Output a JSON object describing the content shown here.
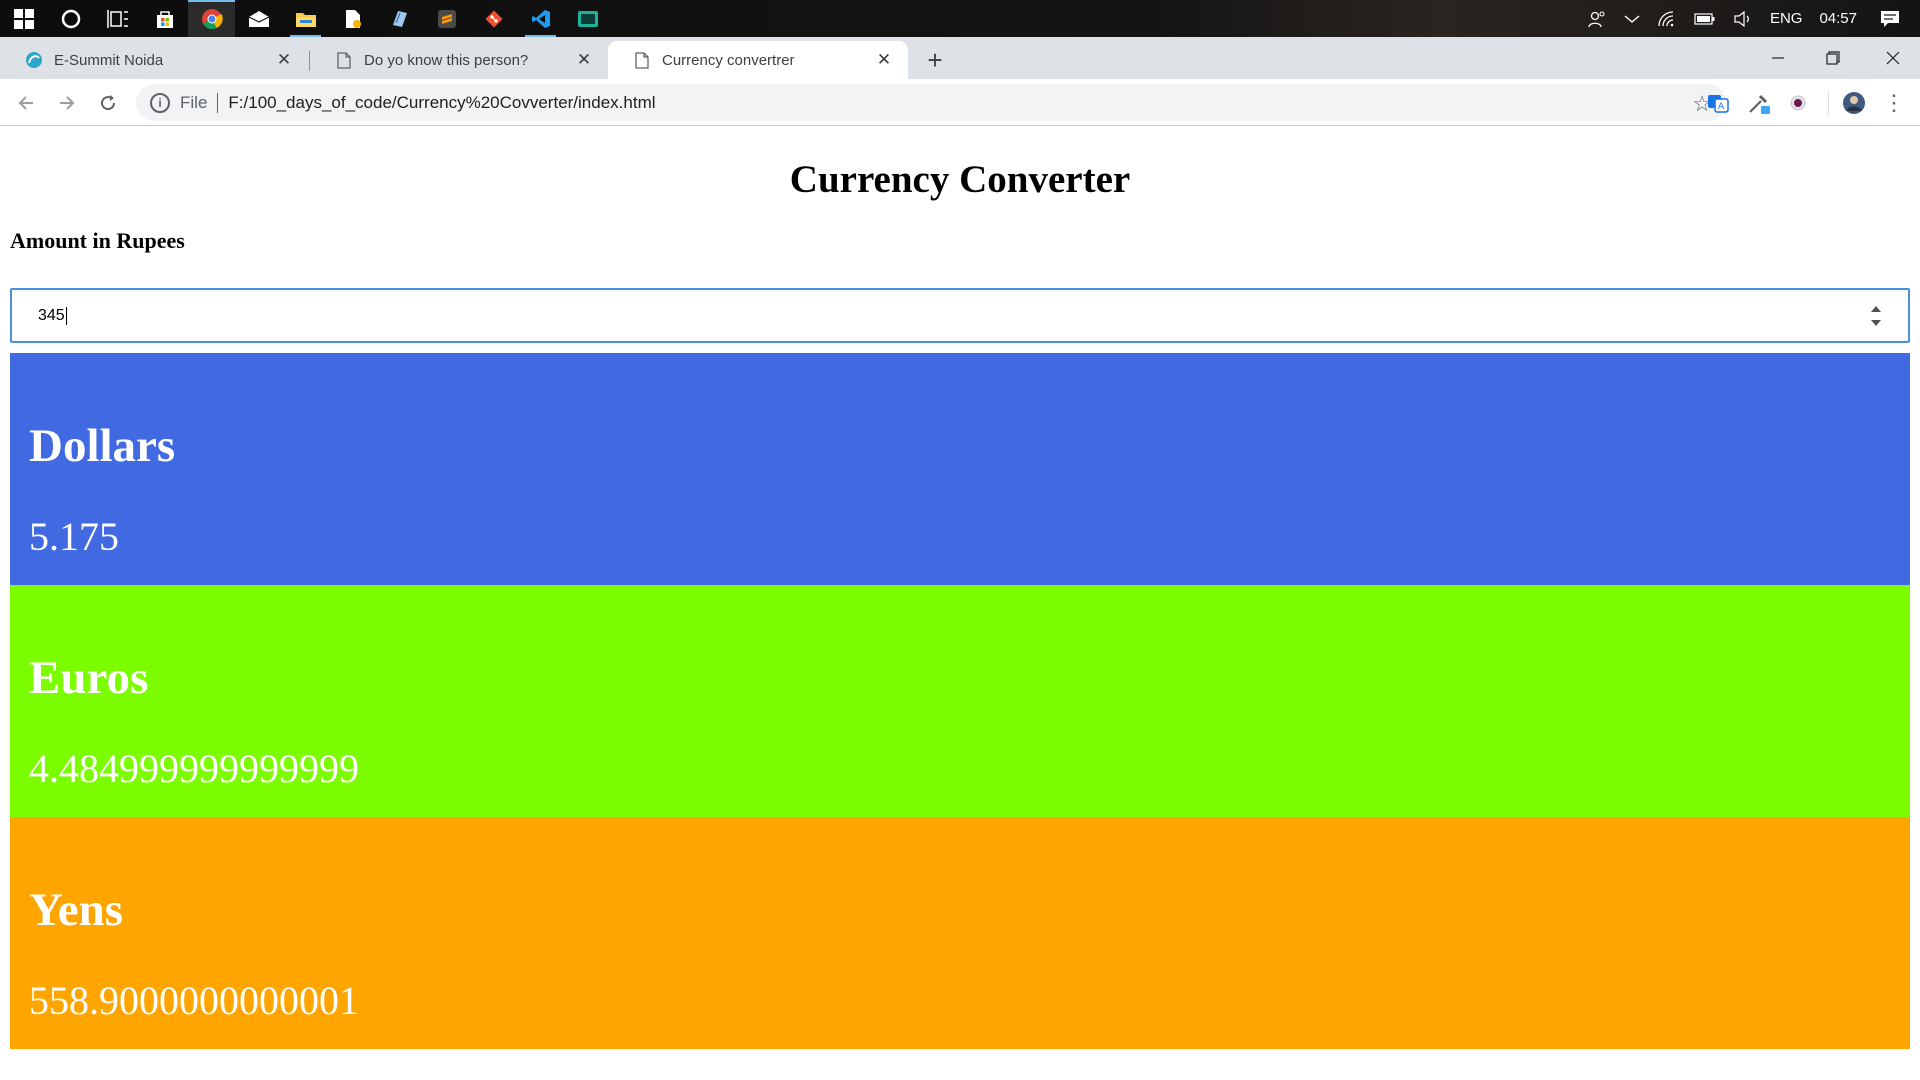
{
  "taskbar": {
    "icons": [
      "windows-start-icon",
      "cortana-search-icon",
      "task-view-icon",
      "store-icon",
      "chrome-icon",
      "mail-icon",
      "file-explorer-icon",
      "document-editor-icon",
      "notes-icon",
      "sublime-text-icon",
      "git-icon",
      "vscode-icon",
      "terminal-icon"
    ],
    "tray": {
      "language": "ENG",
      "time": "04:57"
    }
  },
  "browser": {
    "tabs": [
      {
        "title": "E-Summit Noida",
        "favicon": "esummit-favicon-icon",
        "active": false
      },
      {
        "title": "Do yo know this person?",
        "favicon": "page-icon",
        "active": false
      },
      {
        "title": "Currency convertrer",
        "favicon": "page-icon",
        "active": true
      }
    ],
    "address": {
      "scheme": "File",
      "url": "F:/100_days_of_code/Currency%20Covverter/index.html"
    }
  },
  "page": {
    "title": "Currency Converter",
    "amount_label": "Amount in Rupees",
    "amount_value": "345",
    "currencies": [
      {
        "name": "Dollars",
        "value": "5.175",
        "color": "#4169e1"
      },
      {
        "name": "Euros",
        "value": "4.484999999999999",
        "color": "#7cfc00"
      },
      {
        "name": "Yens",
        "value": "558.9000000000001",
        "color": "#ffa500"
      }
    ]
  }
}
